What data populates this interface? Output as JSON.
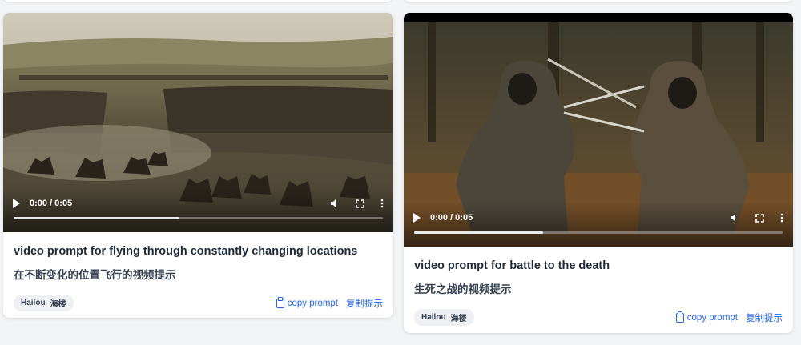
{
  "cards": [
    {
      "video": {
        "time": "0:00 / 0:05",
        "progress": 0.45,
        "icons": [
          "play-icon",
          "volume-icon",
          "fullscreen-icon",
          "more-vertical-icon"
        ]
      },
      "title": "video prompt for flying through constantly changing locations",
      "subtitle": "在不断变化的位置飞行的视频提示",
      "badge": {
        "name": "Hailou",
        "name_cn": "海楼"
      },
      "copy_label": "copy prompt",
      "copy_label_cn": "复制提示"
    },
    {
      "video": {
        "time": "0:00 / 0:05",
        "progress": 0.35,
        "icons": [
          "play-icon",
          "volume-icon",
          "fullscreen-icon",
          "more-vertical-icon"
        ]
      },
      "title": "video prompt for battle to the death",
      "subtitle": "生死之战的视频提示",
      "badge": {
        "name": "Hailou",
        "name_cn": "海楼"
      },
      "copy_label": "copy prompt",
      "copy_label_cn": "复制提示"
    }
  ],
  "colors": {
    "link": "#2563eb",
    "title": "#1f2937"
  }
}
